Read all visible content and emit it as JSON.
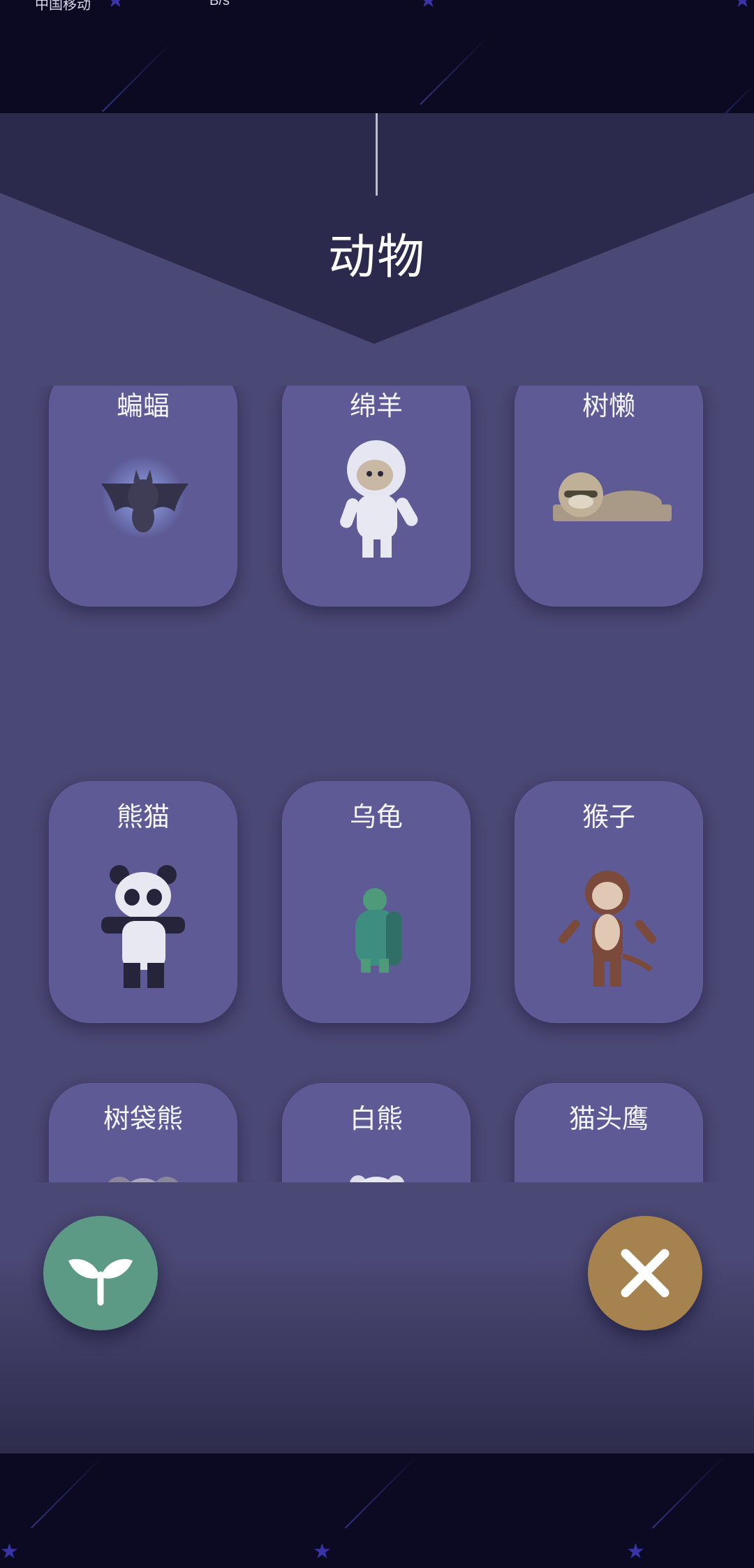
{
  "status_bar": {
    "carrier": "中国移动",
    "speed": "B/s"
  },
  "header": {
    "title": "动物"
  },
  "animals": [
    {
      "name": "蝙蝠",
      "icon": "bat-icon"
    },
    {
      "name": "绵羊",
      "icon": "sheep-icon"
    },
    {
      "name": "树懒",
      "icon": "sloth-icon"
    },
    {
      "name": "熊猫",
      "icon": "panda-icon"
    },
    {
      "name": "乌龟",
      "icon": "turtle-icon"
    },
    {
      "name": "猴子",
      "icon": "monkey-icon"
    },
    {
      "name": "树袋熊",
      "icon": "koala-icon"
    },
    {
      "name": "白熊",
      "icon": "polar-bear-icon"
    },
    {
      "name": "猫头鹰",
      "icon": "owl-icon"
    }
  ],
  "actions": {
    "plant_icon": "sprout-icon",
    "close_icon": "close-icon"
  },
  "colors": {
    "background": "#0b0a22",
    "panel": "#4a4874",
    "card": "#5d5a96",
    "plant_button": "#5d9a86",
    "close_button": "#a6824f"
  }
}
